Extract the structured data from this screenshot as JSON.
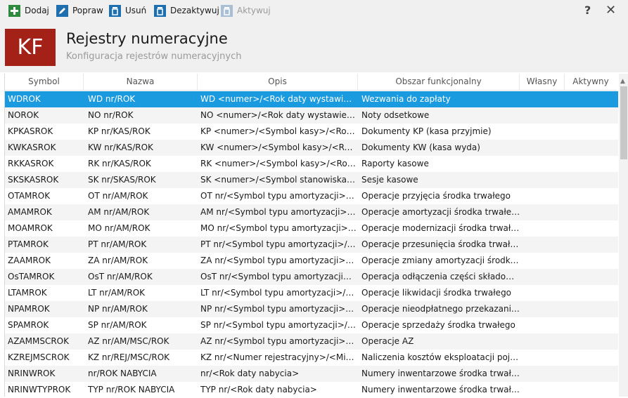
{
  "toolbar": {
    "add_label": "Dodaj",
    "edit_label": "Popraw",
    "delete_label": "Usuń",
    "deactivate_label": "Dezaktywuj",
    "activate_label": "Aktywuj",
    "help_label": "?",
    "close_label": "✕"
  },
  "header": {
    "logo": "KF",
    "title": "Rejestry numeracyjne",
    "subtitle": "Konfiguracja rejestrów numeracyjnych"
  },
  "grid": {
    "columns": [
      "Symbol",
      "Nazwa",
      "Opis",
      "Obszar funkcjonalny",
      "Własny",
      "Aktywny"
    ],
    "rows": [
      {
        "symbol": "WDROK",
        "nazwa": "WD nr/ROK",
        "opis": "WD <numer>/<Rok daty wystawienia>",
        "obszar": "Wezwania do zapłaty"
      },
      {
        "symbol": "NOROK",
        "nazwa": "NO nr/ROK",
        "opis": "NO <numer>/<Rok daty wystawienia>",
        "obszar": "Noty odsetkowe"
      },
      {
        "symbol": "KPKASROK",
        "nazwa": "KP nr/KAS/ROK",
        "opis": "KP <numer>/<Symbol kasy>/<Rok daty wystawienia>",
        "obszar": "Dokumenty KP (kasa przyjmie)"
      },
      {
        "symbol": "KWKASROK",
        "nazwa": "KW nr/KAS/ROK",
        "opis": "KW <numer>/<Symbol kasy>/<Rok daty wystawienia>",
        "obszar": "Dokumenty KW (kasa wyda)"
      },
      {
        "symbol": "RKKASROK",
        "nazwa": "RK nr/KAS/ROK",
        "opis": "RK <numer>/<Symbol kasy>/<Rok daty wystawienia>",
        "obszar": "Raporty kasowe"
      },
      {
        "symbol": "SKSKASROK",
        "nazwa": "SK nr/SKAS/ROK",
        "opis": "SK <numer>/<Symbol stanowiska>/<Rok daty wystawienia>",
        "obszar": "Sesje kasowe"
      },
      {
        "symbol": "OTAMROK",
        "nazwa": "OT nr/AM/ROK",
        "opis": "OT nr/<Symbol typu amortyzacji>/<Rok daty>",
        "obszar": "Operacje przyjęcia środka trwałego"
      },
      {
        "symbol": "AMAMROK",
        "nazwa": "AM nr/AM/ROK",
        "opis": "AM nr/<Symbol typu amortyzacji>/<Rok daty>",
        "obszar": "Operacje amortyzacji środka trwałego"
      },
      {
        "symbol": "MOAMROK",
        "nazwa": "MO nr/AM/ROK",
        "opis": "MO nr/<Symbol typu amortyzacji>/<Rok daty>",
        "obszar": "Operacje modernizacji środka trwałego"
      },
      {
        "symbol": "PTAMROK",
        "nazwa": "PT nr/AM/ROK",
        "opis": "PT nr/<Symbol typu amortyzacji>/<Rok daty>",
        "obszar": "Operacje przesunięcia środka trwałego"
      },
      {
        "symbol": "ZAAMROK",
        "nazwa": "ZA nr/AM/ROK",
        "opis": "ZA nr/<Symbol typu amortyzacji>/<Rok daty>",
        "obszar": "Operacje zmiany amortyzacji środka trwałego"
      },
      {
        "symbol": "OsTAMROK",
        "nazwa": "OsT nr/AM/ROK",
        "opis": "OsT nr/<Symbol typu amortyzacji>/<Rok daty>",
        "obszar": "Operacja odłączenia części składowej środka trwałego"
      },
      {
        "symbol": "LTAMROK",
        "nazwa": "LT nr/AM/ROK",
        "opis": "LT nr/<Symbol typu amortyzacji>/<Rok daty>",
        "obszar": "Operacje likwidacji środka trwałego"
      },
      {
        "symbol": "NPAMROK",
        "nazwa": "NP nr/AM/ROK",
        "opis": "NP nr/<Symbol typu amortyzacji>/<Rok daty>",
        "obszar": "Operacje nieodpłatnego przekazania środka trwałego"
      },
      {
        "symbol": "SPAMROK",
        "nazwa": "SP nr/AM/ROK",
        "opis": "SP nr/<Symbol typu amortyzacji>/<Rok daty>",
        "obszar": "Operacje sprzedaży środka trwałego"
      },
      {
        "symbol": "AZAMMSCROK",
        "nazwa": "AZ nr/AM/MSC/ROK",
        "opis": "AZ nr/<Symbol typu amortyzacji>/<Miesiąc>/<Rok>",
        "obszar": "Operacje AZ"
      },
      {
        "symbol": "KZREJMSCROK",
        "nazwa": "KZ nr/REJ/MSC/ROK",
        "opis": "KZ nr/<Numer rejestracyjny>/<Miesiąc>/<Rok>",
        "obszar": "Naliczenia kosztów eksploatacji pojazdów"
      },
      {
        "symbol": "NRINWROK",
        "nazwa": "nr/ROK NABYCIA",
        "opis": "nr/<Rok daty nabycia>",
        "obszar": "Numery inwentarzowe środka trwałego"
      },
      {
        "symbol": "NRINWTYPROK",
        "nazwa": "TYP nr/ROK NABYCIA",
        "opis": "TYP nr/<Rok daty nabycia>",
        "obszar": "Numery inwentarzowe środka trwałego"
      }
    ]
  }
}
